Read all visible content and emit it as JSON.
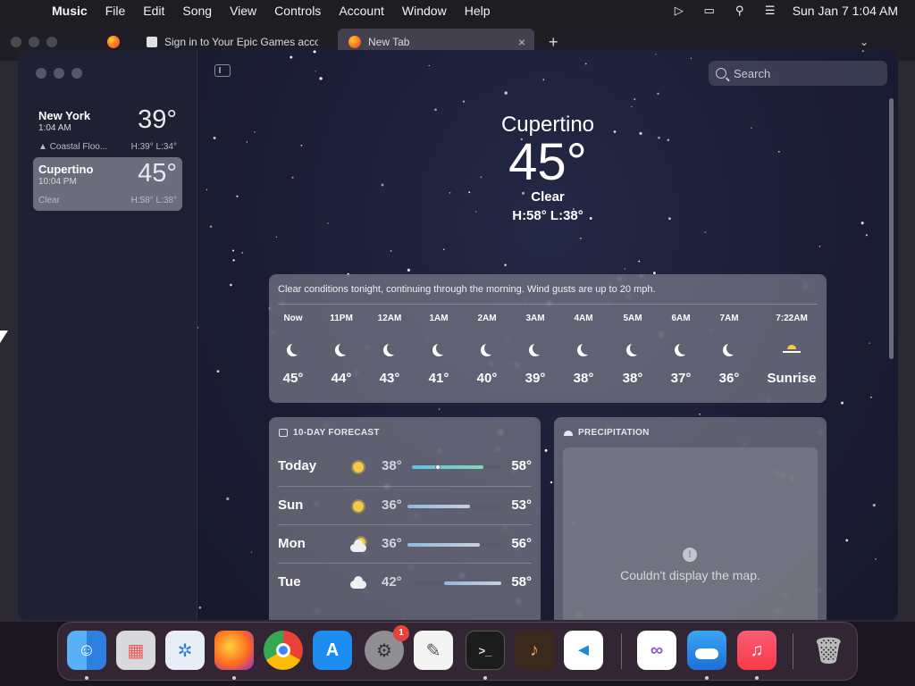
{
  "menubar": {
    "app_name": "Music",
    "items": [
      "File",
      "Edit",
      "Song",
      "View",
      "Controls",
      "Account",
      "Window",
      "Help"
    ],
    "clock": "Sun Jan 7  1:04 AM"
  },
  "browser": {
    "tabs": [
      {
        "title": "Sign in to Your Epic Games acco"
      },
      {
        "title": "New Tab"
      }
    ],
    "new_tab_symbol": "+"
  },
  "weather": {
    "search_placeholder": "Search",
    "locations": [
      {
        "city": "New York",
        "time": "1:04 AM",
        "temp": "39°",
        "condition": "Coastal Floo...",
        "hl": "H:39°  L:34°"
      },
      {
        "city": "Cupertino",
        "time": "10:04 PM",
        "temp": "45°",
        "condition": "Clear",
        "hl": "H:58°  L:38°"
      }
    ],
    "current": {
      "city": "Cupertino",
      "temp": "45°",
      "condition": "Clear",
      "hl": "H:58°  L:38°"
    },
    "hourly": {
      "summary": "Clear conditions tonight, continuing through the morning. Wind gusts are up to 20 mph.",
      "hours": [
        {
          "label": "Now",
          "icon": "moon-icon",
          "value": "45°"
        },
        {
          "label": "11PM",
          "icon": "moon-icon",
          "value": "44°"
        },
        {
          "label": "12AM",
          "icon": "moon-icon",
          "value": "43°"
        },
        {
          "label": "1AM",
          "icon": "moon-icon",
          "value": "41°"
        },
        {
          "label": "2AM",
          "icon": "moon-icon",
          "value": "40°"
        },
        {
          "label": "3AM",
          "icon": "moon-icon",
          "value": "39°"
        },
        {
          "label": "4AM",
          "icon": "moon-icon",
          "value": "38°"
        },
        {
          "label": "5AM",
          "icon": "moon-icon",
          "value": "38°"
        },
        {
          "label": "6AM",
          "icon": "moon-icon",
          "value": "37°"
        },
        {
          "label": "7AM",
          "icon": "moon-icon",
          "value": "36°"
        },
        {
          "label": "7:22AM",
          "icon": "sunrise-icon",
          "value": "Sunrise"
        }
      ]
    },
    "forecast": {
      "title": "10-DAY FORECAST",
      "days": [
        {
          "day": "Today",
          "icon": "sun-icon",
          "low": "38°",
          "high": "58°"
        },
        {
          "day": "Sun",
          "icon": "sun-icon",
          "low": "36°",
          "high": "53°"
        },
        {
          "day": "Mon",
          "icon": "partly-cloudy-icon",
          "low": "36°",
          "high": "56°"
        },
        {
          "day": "Tue",
          "icon": "cloud-icon",
          "low": "42°",
          "high": "58°"
        }
      ]
    },
    "precipitation": {
      "title": "PRECIPITATION",
      "message": "Couldn't display the map."
    }
  },
  "dock": {
    "apps": [
      "Finder",
      "Launchpad",
      "Safari",
      "Firefox",
      "Chrome",
      "App Store",
      "System Settings",
      "TextEdit",
      "Terminal",
      "GarageBand",
      "VS Code",
      "Visual Studio",
      "Weather",
      "Music",
      "Trash"
    ],
    "settings_badge": "1"
  }
}
